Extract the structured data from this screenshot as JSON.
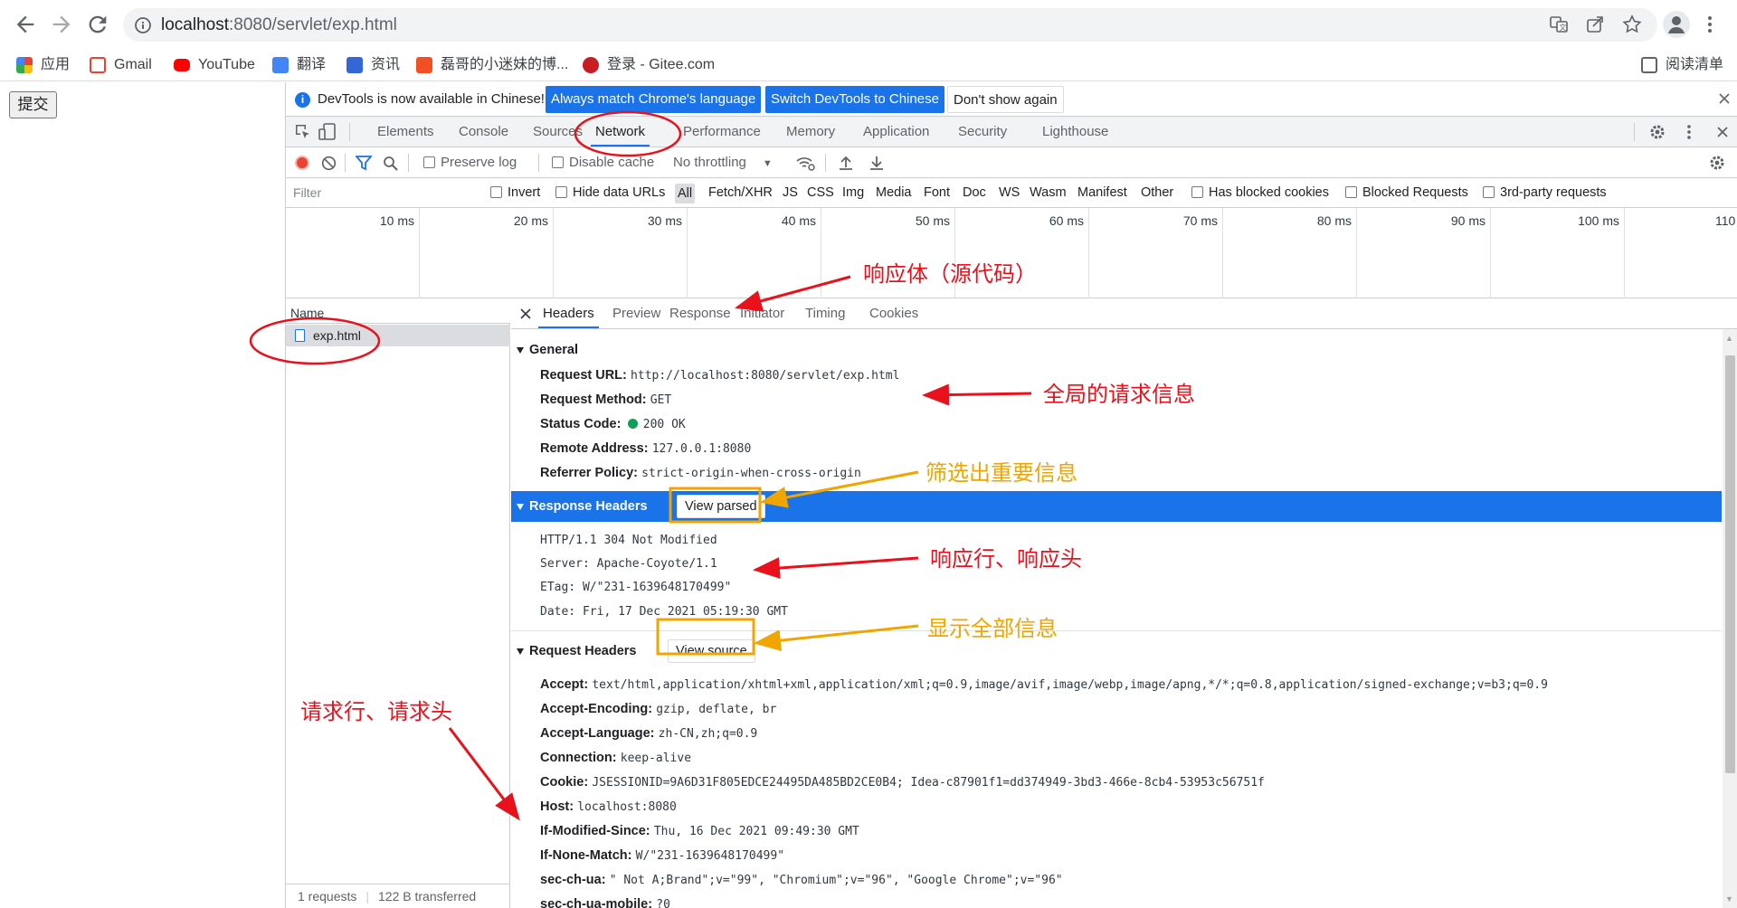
{
  "browser": {
    "url_host": "localhost",
    "url_rest": ":8080/servlet/exp.html",
    "bookmarks": [
      {
        "label": "应用",
        "color": "#f4511e"
      },
      {
        "label": "Gmail",
        "color": "#ea4335"
      },
      {
        "label": "YouTube",
        "color": "#ff0000"
      },
      {
        "label": "翻译",
        "color": "#4285f4"
      },
      {
        "label": "资讯",
        "color": "#3367d6"
      },
      {
        "label": "磊哥的小迷妹的博...",
        "color": "#f25022"
      },
      {
        "label": "登录 - Gitee.com",
        "color": "#c71d23"
      }
    ],
    "reading_list": "阅读清单"
  },
  "page": {
    "submit_label": "提交"
  },
  "devtools": {
    "infobar": {
      "message": "DevTools is now available in Chinese!",
      "btn_match": "Always match Chrome's language",
      "btn_switch": "Switch DevTools to Chinese",
      "btn_dismiss": "Don't show again"
    },
    "tabs": [
      "Elements",
      "Console",
      "Sources",
      "Network",
      "Performance",
      "Memory",
      "Application",
      "Security",
      "Lighthouse"
    ],
    "toolbar": {
      "preserve_log": "Preserve log",
      "disable_cache": "Disable cache",
      "throttling": "No throttling"
    },
    "filter": {
      "placeholder": "Filter",
      "invert": "Invert",
      "hide_data_urls": "Hide data URLs",
      "types": [
        "All",
        "Fetch/XHR",
        "JS",
        "CSS",
        "Img",
        "Media",
        "Font",
        "Doc",
        "WS",
        "Wasm",
        "Manifest",
        "Other"
      ],
      "has_blocked_cookies": "Has blocked cookies",
      "blocked_requests": "Blocked Requests",
      "third_party": "3rd-party requests"
    },
    "timeline_ticks": [
      "10 ms",
      "20 ms",
      "30 ms",
      "40 ms",
      "50 ms",
      "60 ms",
      "70 ms",
      "80 ms",
      "90 ms",
      "100 ms",
      "110"
    ],
    "requests": {
      "name_header": "Name",
      "row": "exp.html",
      "count": "1 requests",
      "transferred": "122 B transferred"
    },
    "detail_tabs": [
      "Headers",
      "Preview",
      "Response",
      "Initiator",
      "Timing",
      "Cookies"
    ],
    "general": {
      "title": "General",
      "rows": [
        {
          "k": "Request URL:",
          "v": "http://localhost:8080/servlet/exp.html"
        },
        {
          "k": "Request Method:",
          "v": "GET"
        },
        {
          "k": "Status Code:",
          "v": "200 OK"
        },
        {
          "k": "Remote Address:",
          "v": "127.0.0.1:8080"
        },
        {
          "k": "Referrer Policy:",
          "v": "strict-origin-when-cross-origin"
        }
      ]
    },
    "response_headers": {
      "title": "Response Headers",
      "view_btn": "View parsed",
      "lines": [
        "HTTP/1.1 304 Not Modified",
        "Server: Apache-Coyote/1.1",
        "ETag: W/\"231-1639648170499\"",
        "Date: Fri, 17 Dec 2021 05:19:30 GMT"
      ]
    },
    "request_headers": {
      "title": "Request Headers",
      "view_btn": "View source",
      "rows": [
        {
          "k": "Accept:",
          "v": "text/html,application/xhtml+xml,application/xml;q=0.9,image/avif,image/webp,image/apng,*/*;q=0.8,application/signed-exchange;v=b3;q=0.9"
        },
        {
          "k": "Accept-Encoding:",
          "v": "gzip, deflate, br"
        },
        {
          "k": "Accept-Language:",
          "v": "zh-CN,zh;q=0.9"
        },
        {
          "k": "Connection:",
          "v": "keep-alive"
        },
        {
          "k": "Cookie:",
          "v": "JSESSIONID=9A6D31F805EDCE24495DA485BD2CE0B4; Idea-c87901f1=dd374949-3bd3-466e-8cb4-53953c56751f"
        },
        {
          "k": "Host:",
          "v": "localhost:8080"
        },
        {
          "k": "If-Modified-Since:",
          "v": "Thu, 16 Dec 2021 09:49:30 GMT"
        },
        {
          "k": "If-None-Match:",
          "v": "W/\"231-1639648170499\""
        },
        {
          "k": "sec-ch-ua:",
          "v": "\" Not A;Brand\";v=\"99\", \"Chromium\";v=\"96\", \"Google Chrome\";v=\"96\""
        },
        {
          "k": "sec-ch-ua-mobile:",
          "v": "?0"
        }
      ]
    }
  },
  "annotations": {
    "response_body": "响应体（源代码）",
    "general_info": "全局的请求信息",
    "filter_important": "筛选出重要信息",
    "response_line_headers": "响应行、响应头",
    "show_all": "显示全部信息",
    "request_line_headers": "请求行、请求头"
  },
  "colors": {
    "accent": "#1a73e8",
    "annotation_red": "#e8111c",
    "annotation_yellow": "#f0a500",
    "status_green": "#0f9d58",
    "record_red": "#ea4335"
  }
}
